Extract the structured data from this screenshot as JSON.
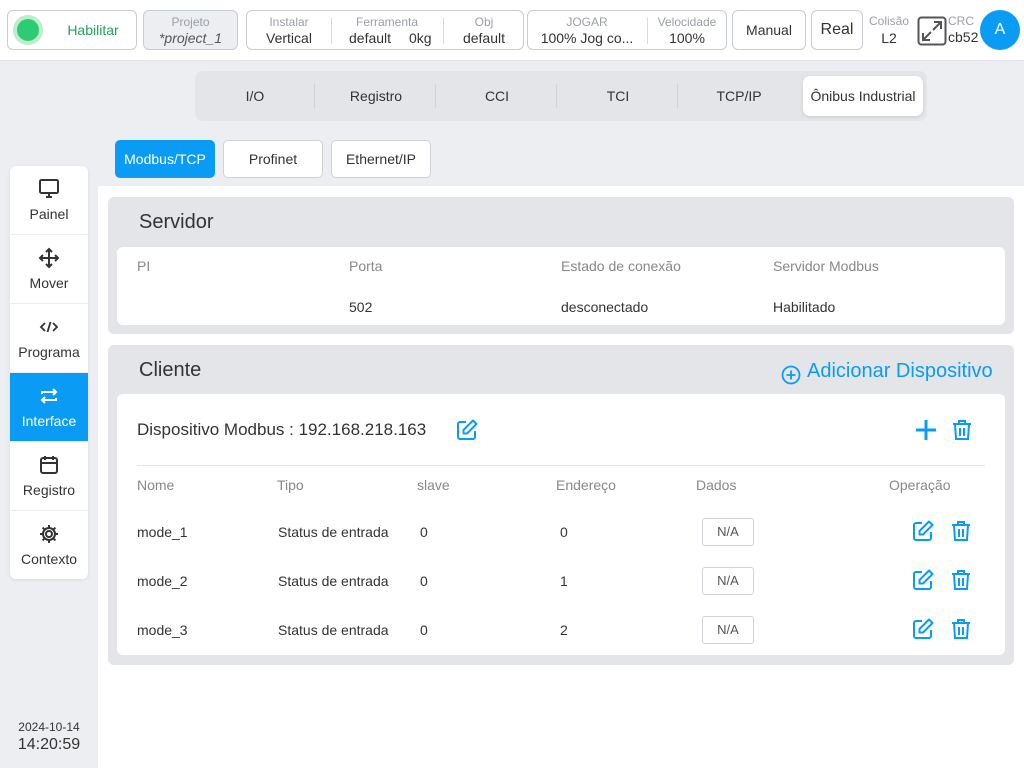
{
  "topbar": {
    "enable_label": "Habilitar",
    "project": {
      "caption": "Projeto",
      "value": "*project_1"
    },
    "install": {
      "caption": "Instalar",
      "value": "Vertical"
    },
    "tool": {
      "caption": "Ferramenta",
      "value_a": "default",
      "value_b": "0kg"
    },
    "obj": {
      "caption": "Obj",
      "value": "default"
    },
    "jog": {
      "caption": "JOGAR",
      "value": "100%  Jog co..."
    },
    "speed": {
      "caption": "Velocidade",
      "value": "100%"
    },
    "manual_label": "Manual",
    "real_label": "Real",
    "collision": {
      "caption": "Colisão",
      "value": "L2"
    },
    "crc": {
      "caption": "CRC",
      "value": "cb52"
    },
    "avatar_letter": "A",
    "colors": {
      "accent": "#0a9cf5",
      "enable_green": "#2ecc71"
    }
  },
  "sidebar": {
    "items": [
      {
        "label": "Painel",
        "icon": "monitor-icon"
      },
      {
        "label": "Mover",
        "icon": "move-arrows-icon"
      },
      {
        "label": "Programa",
        "icon": "code-icon"
      },
      {
        "label": "Interface",
        "icon": "swap-arrows-icon",
        "active": true
      },
      {
        "label": "Registro",
        "icon": "calendar-icon"
      },
      {
        "label": "Contexto",
        "icon": "gear-icon"
      }
    ],
    "date": "2024-10-14",
    "time": "14:20:59"
  },
  "tabs": [
    "I/O",
    "Registro",
    "CCI",
    "TCI",
    "TCP/IP",
    "Ônibus Industrial"
  ],
  "active_tab": "Ônibus Industrial",
  "subtabs": [
    "Modbus/TCP",
    "Profinet",
    "Ethernet/IP"
  ],
  "active_subtab": "Modbus/TCP",
  "server": {
    "title": "Servidor",
    "headers": [
      "PI",
      "Porta",
      "Estado de conexão",
      "Servidor Modbus"
    ],
    "values": [
      "",
      "502",
      "desconectado",
      "Habilitado"
    ]
  },
  "client": {
    "title": "Cliente",
    "add_device_label": "Adicionar Dispositivo",
    "device_title": "Dispositivo Modbus : 192.168.218.163",
    "headers": [
      "Nome",
      "Tipo",
      "slave",
      "Endereço",
      "Dados",
      "Operação"
    ],
    "rows": [
      {
        "name": "mode_1",
        "type": "Status de entrada",
        "slave": "0",
        "address": "0",
        "data": "N/A"
      },
      {
        "name": "mode_2",
        "type": "Status de entrada",
        "slave": "0",
        "address": "1",
        "data": "N/A"
      },
      {
        "name": "mode_3",
        "type": "Status de entrada",
        "slave": "0",
        "address": "2",
        "data": "N/A"
      }
    ]
  }
}
